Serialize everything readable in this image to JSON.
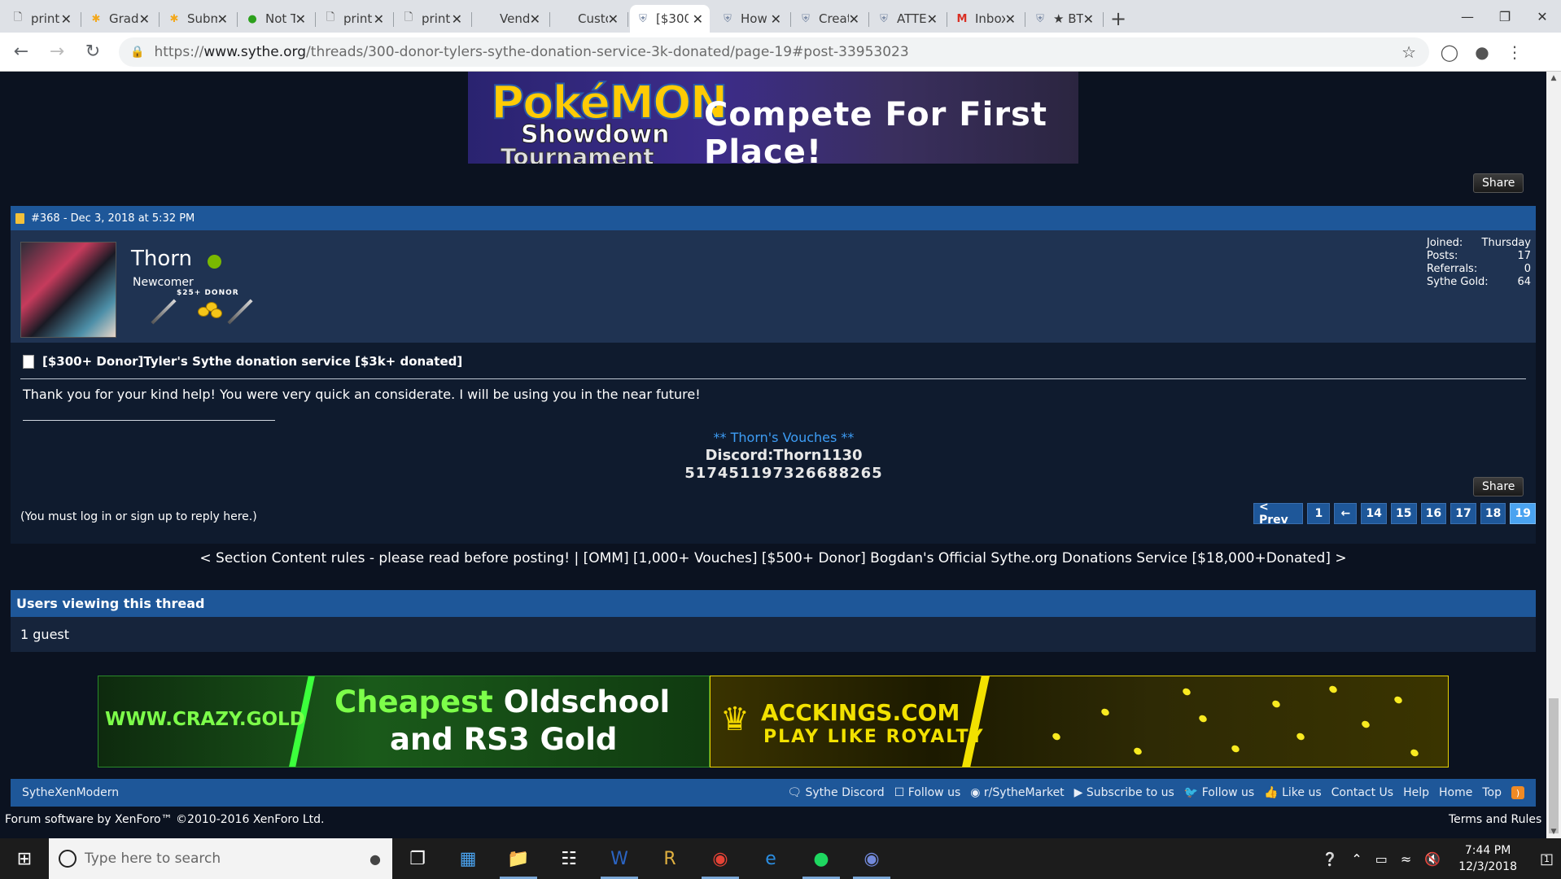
{
  "browser": {
    "tabs": [
      {
        "label": "print",
        "icon": "page-icon",
        "active": false
      },
      {
        "label": "Grade",
        "icon": "asterisk-icon",
        "active": false
      },
      {
        "label": "Subm",
        "icon": "asterisk-icon",
        "active": false
      },
      {
        "label": "Not T",
        "icon": "qb-icon",
        "active": false
      },
      {
        "label": "print",
        "icon": "page-icon",
        "active": false
      },
      {
        "label": "print",
        "icon": "page-icon",
        "active": false
      },
      {
        "label": "Vend",
        "icon": "blank-icon",
        "active": false
      },
      {
        "label": "Custo",
        "icon": "blank-icon",
        "active": false
      },
      {
        "label": "[$300",
        "icon": "shield-icon",
        "active": true
      },
      {
        "label": "How",
        "icon": "shield-icon",
        "active": false
      },
      {
        "label": "Creat",
        "icon": "shield-icon",
        "active": false
      },
      {
        "label": "ATTE",
        "icon": "shield-icon",
        "active": false
      },
      {
        "label": "Inbox",
        "icon": "gmail-icon",
        "active": false
      },
      {
        "label": "★ BTC",
        "icon": "shield-icon",
        "active": false
      }
    ],
    "url_scheme": "https://",
    "url_host": "www.sythe.org",
    "url_path": "/threads/300-donor-tylers-sythe-donation-service-3k-donated/page-19#post-33953023"
  },
  "promo": {
    "pokemon": "PokéMON",
    "showdown": "Showdown",
    "tournament": "Tournament",
    "cta": "Compete For First Place!"
  },
  "share_label": "Share",
  "post": {
    "header": "#368 - Dec 3, 2018 at 5:32 PM",
    "username": "Thorn",
    "user_title": "Newcomer",
    "ribbon_text": "$25+ DONOR",
    "stats": [
      {
        "label": "Joined:",
        "value": "Thursday"
      },
      {
        "label": "Posts:",
        "value": "17"
      },
      {
        "label": "Referrals:",
        "value": "0"
      },
      {
        "label": "Sythe Gold:",
        "value": "64"
      }
    ],
    "thread_title": "[$300+ Donor]Tyler's Sythe donation service [$3k+ donated]",
    "message": "Thank you for your kind help! You were very quick an considerate. I will be using you in the near future!",
    "signature": {
      "vouches": "** Thorn's Vouches **",
      "discord": "Discord:Thorn1130",
      "id": "517451197326688265"
    }
  },
  "login_note": "(You must log in or sign up to reply here.)",
  "pagination": {
    "prev": "< Prev",
    "pages": [
      "1",
      "←",
      "14",
      "15",
      "16",
      "17",
      "18",
      "19"
    ],
    "current": "19"
  },
  "nav_links": "< Section Content rules - please read before posting! | [OMM] [1,000+ Vouches] [$500+ Donor] Bogdan's Official Sythe.org Donations Service [$18,000+Donated] >",
  "viewers": {
    "title": "Users viewing this thread",
    "body": "1 guest"
  },
  "ads": {
    "left_site": "WWW.CRAZY.GOLD",
    "left_h1_accent": "Cheapest",
    "left_h1_rest": " Oldschool",
    "left_h2": "and RS3 Gold",
    "right_t1": "ACCKINGS.COM",
    "right_t2": "PLAY LIKE ROYALTY"
  },
  "footer": {
    "style_name": "SytheXenModern",
    "links": [
      "Sythe Discord",
      "Follow us",
      "r/SytheMarket",
      "Subscribe to us",
      "Follow us",
      "Like us",
      "Contact Us",
      "Help",
      "Home",
      "Top"
    ],
    "credit": "Forum software by XenForo™ ©2010-2016 XenForo Ltd.",
    "terms": "Terms and Rules"
  },
  "taskbar": {
    "search_placeholder": "Type here to search",
    "time": "7:44 PM",
    "date": "12/3/2018",
    "notifications": "1"
  }
}
